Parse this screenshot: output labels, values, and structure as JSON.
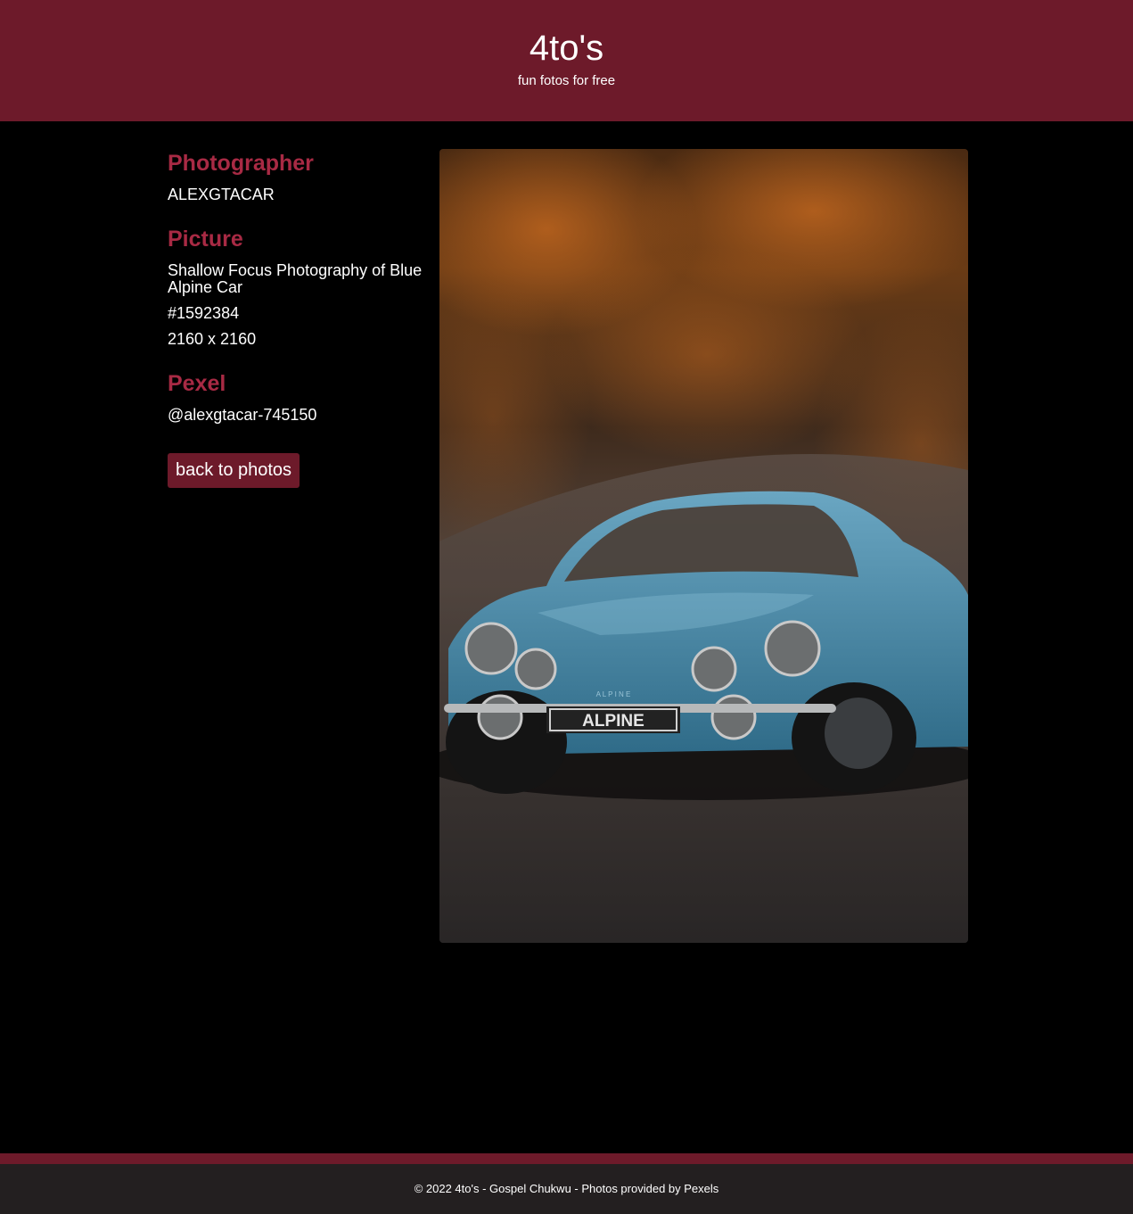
{
  "header": {
    "title": "4to's",
    "tagline": "fun fotos for free"
  },
  "details": {
    "photographer_heading": "Photographer",
    "photographer_name": "ALEXGTACAR",
    "picture_heading": "Picture",
    "picture_title": "Shallow Focus Photography of Blue Alpine Car",
    "picture_id": "#1592384",
    "picture_size": "2160 x 2160",
    "pexel_heading": "Pexel",
    "pexel_handle": "@alexgtacar-745150"
  },
  "back_button_label": "back to photos",
  "photo": {
    "plate_text": "ALPINE",
    "badge_text": "A L P I N E"
  },
  "footer": {
    "text": "© 2022 4to's - Gospel Chukwu - Photos provided by Pexels"
  },
  "colors": {
    "brand": "#6d1a2a",
    "heading": "#a82a44",
    "background": "#000000",
    "footer": "#231f20"
  }
}
